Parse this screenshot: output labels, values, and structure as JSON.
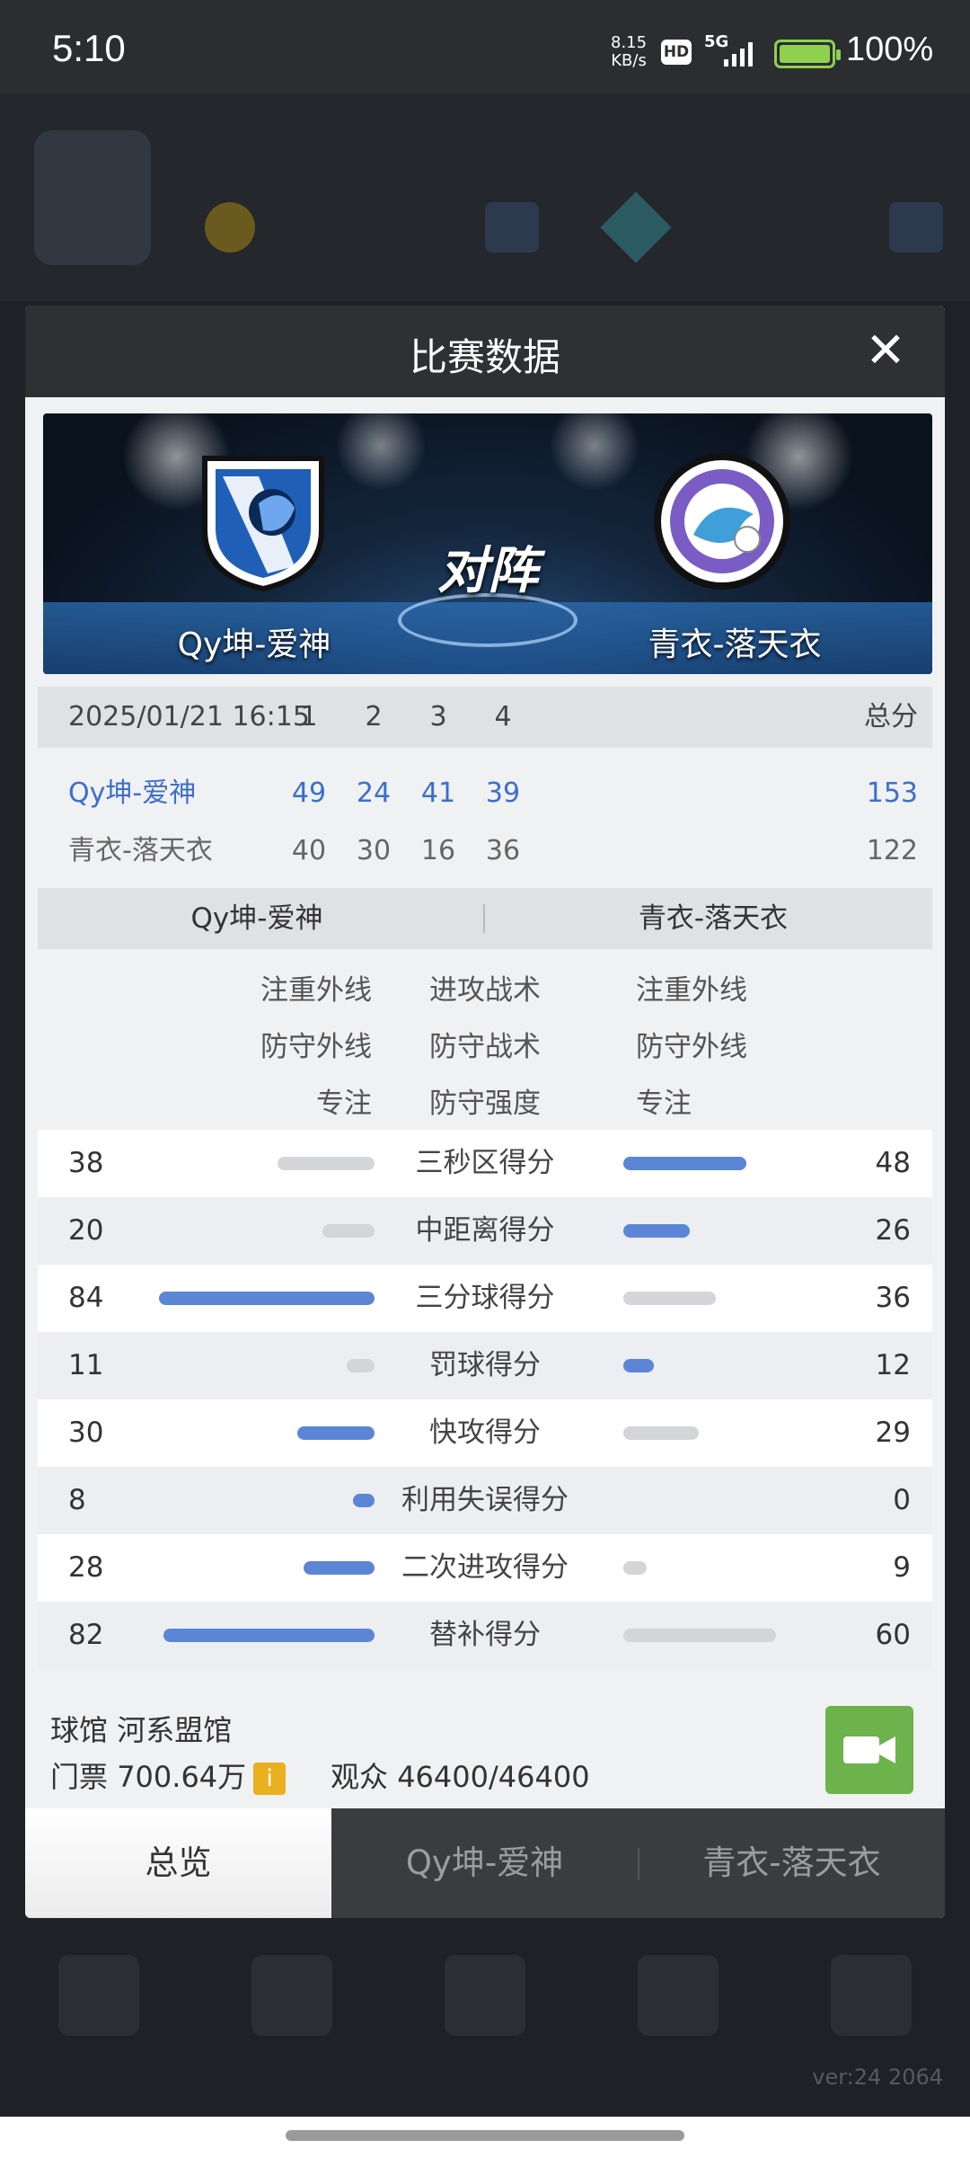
{
  "status_bar": {
    "time": "5:10",
    "speed": "8.15",
    "speed_unit": "KB/s",
    "hd": "HD",
    "network": "5G",
    "battery": "100%"
  },
  "modal": {
    "title": "比赛数据",
    "close_glyph": "✕",
    "banner": {
      "vs": "对阵",
      "home_team": "Qy坤-爱神",
      "away_team": "青衣-落天衣"
    },
    "score_table": {
      "datetime": "2025/01/21 16:15",
      "q1": "1",
      "q2": "2",
      "q3": "3",
      "q4": "4",
      "total_label": "总分",
      "home": {
        "name": "Qy坤-爱神",
        "q1": "49",
        "q2": "24",
        "q3": "41",
        "q4": "39",
        "total": "153"
      },
      "away": {
        "name": "青衣-落天衣",
        "q1": "40",
        "q2": "30",
        "q3": "16",
        "q4": "36",
        "total": "122"
      }
    },
    "tactics": {
      "home_team": "Qy坤-爱神",
      "away_team": "青衣-落天衣",
      "rows": [
        {
          "home": "注重外线",
          "label": "进攻战术",
          "away": "注重外线"
        },
        {
          "home": "防守外线",
          "label": "防守战术",
          "away": "防守外线"
        },
        {
          "home": "专注",
          "label": "防守强度",
          "away": "专注"
        }
      ]
    },
    "stats": [
      {
        "label": "三秒区得分",
        "home": "38",
        "away": "48",
        "home_fill": 0.45,
        "away_fill": 0.57,
        "leader": "away"
      },
      {
        "label": "中距离得分",
        "home": "20",
        "away": "26",
        "home_fill": 0.24,
        "away_fill": 0.31,
        "leader": "away"
      },
      {
        "label": "三分球得分",
        "home": "84",
        "away": "36",
        "home_fill": 1.0,
        "away_fill": 0.43,
        "leader": "home"
      },
      {
        "label": "罚球得分",
        "home": "11",
        "away": "12",
        "home_fill": 0.13,
        "away_fill": 0.14,
        "leader": "away"
      },
      {
        "label": "快攻得分",
        "home": "30",
        "away": "29",
        "home_fill": 0.36,
        "away_fill": 0.35,
        "leader": "home"
      },
      {
        "label": "利用失误得分",
        "home": "8",
        "away": "0",
        "home_fill": 0.1,
        "away_fill": 0.0,
        "leader": "home"
      },
      {
        "label": "二次进攻得分",
        "home": "28",
        "away": "9",
        "home_fill": 0.33,
        "away_fill": 0.11,
        "leader": "home"
      },
      {
        "label": "替补得分",
        "home": "82",
        "away": "60",
        "home_fill": 0.98,
        "away_fill": 0.71,
        "leader": "home"
      }
    ],
    "venue_label": "球馆",
    "venue": "河系盟馆",
    "ticket_label": "门票",
    "ticket_value": "700.64万",
    "ticket_icon": "i",
    "audience_label": "观众",
    "audience": "46400/46400",
    "tabs": [
      "总览",
      "Qy坤-爱神",
      "青衣-落天衣"
    ],
    "active_tab": 0
  },
  "background": {
    "version": "ver:24",
    "build": "2064"
  },
  "colors": {
    "accent_blue": "#5b86d6",
    "bar_gray": "#d4d5d8",
    "video_green": "#6bb34a",
    "ticket_yellow": "#e9b120"
  }
}
